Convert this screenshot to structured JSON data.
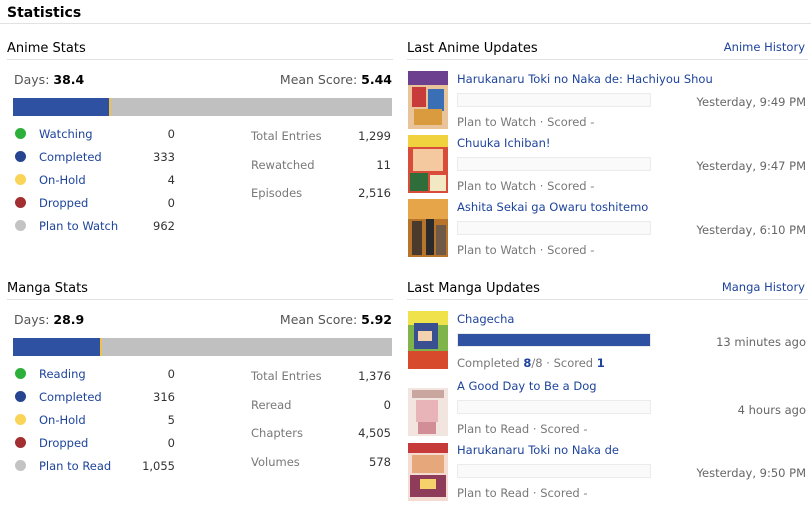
{
  "page_title": "Statistics",
  "anime": {
    "section_title": "Anime Stats",
    "days_label": "Days:",
    "days_value": "38.4",
    "mean_label": "Mean Score:",
    "mean_value": "5.44",
    "bar": {
      "completed_fraction": 0.252,
      "colors": {
        "completed": "#2e51a2",
        "on_hold": "#f0c24a",
        "rest": "#c0c0c0"
      }
    },
    "statuses": [
      {
        "label": "Watching",
        "value": "0",
        "color": "#2db039"
      },
      {
        "label": "Completed",
        "value": "333",
        "color": "#26448f"
      },
      {
        "label": "On-Hold",
        "value": "4",
        "color": "#f9d457"
      },
      {
        "label": "Dropped",
        "value": "0",
        "color": "#a12f31"
      },
      {
        "label": "Plan to Watch",
        "value": "962",
        "color": "#c3c3c3"
      }
    ],
    "totals": [
      {
        "label": "Total Entries",
        "value": "1,299"
      },
      {
        "label": "Rewatched",
        "value": "11"
      },
      {
        "label": "Episodes",
        "value": "2,516"
      }
    ]
  },
  "manga": {
    "section_title": "Manga Stats",
    "days_label": "Days:",
    "days_value": "28.9",
    "mean_label": "Mean Score:",
    "mean_value": "5.92",
    "bar": {
      "completed_fraction": 0.229,
      "colors": {
        "completed": "#2e51a2",
        "on_hold": "#f0c24a",
        "rest": "#c0c0c0"
      }
    },
    "statuses": [
      {
        "label": "Reading",
        "value": "0",
        "color": "#2db039"
      },
      {
        "label": "Completed",
        "value": "316",
        "color": "#26448f"
      },
      {
        "label": "On-Hold",
        "value": "5",
        "color": "#f9d457"
      },
      {
        "label": "Dropped",
        "value": "0",
        "color": "#a12f31"
      },
      {
        "label": "Plan to Read",
        "value": "1,055",
        "color": "#c3c3c3"
      }
    ],
    "totals": [
      {
        "label": "Total Entries",
        "value": "1,376"
      },
      {
        "label": "Reread",
        "value": "0"
      },
      {
        "label": "Chapters",
        "value": "4,505"
      },
      {
        "label": "Volumes",
        "value": "578"
      }
    ]
  },
  "anime_updates": {
    "section_title": "Last Anime Updates",
    "history_link": "Anime History",
    "items": [
      {
        "title": "Harukanaru Toki no Naka de: Hachiyou Shou",
        "status": "Plan to Watch",
        "sep": "·",
        "scored_label": "Scored",
        "score": "-",
        "time": "Yesterday, 9:49 PM",
        "progress": 0
      },
      {
        "title": "Chuuka Ichiban!",
        "status": "Plan to Watch",
        "sep": "·",
        "scored_label": "Scored",
        "score": "-",
        "time": "Yesterday, 9:47 PM",
        "progress": 0
      },
      {
        "title": "Ashita Sekai ga Owaru toshitemo",
        "status": "Plan to Watch",
        "sep": "·",
        "scored_label": "Scored",
        "score": "-",
        "time": "Yesterday, 6:10 PM",
        "progress": 0
      }
    ]
  },
  "manga_updates": {
    "section_title": "Last Manga Updates",
    "history_link": "Manga History",
    "items": [
      {
        "title": "Chagecha",
        "status": "Completed",
        "progress_count": "8",
        "progress_total": "/8",
        "sep": "·",
        "scored_label": "Scored",
        "score": "1",
        "time": "13 minutes ago",
        "progress": 1
      },
      {
        "title": "A Good Day to Be a Dog",
        "status": "Plan to Read",
        "sep": "·",
        "scored_label": "Scored",
        "score": "-",
        "time": "4 hours ago",
        "progress": 0
      },
      {
        "title": "Harukanaru Toki no Naka de",
        "status": "Plan to Read",
        "sep": "·",
        "scored_label": "Scored",
        "score": "-",
        "time": "Yesterday, 9:50 PM",
        "progress": 0
      }
    ]
  }
}
